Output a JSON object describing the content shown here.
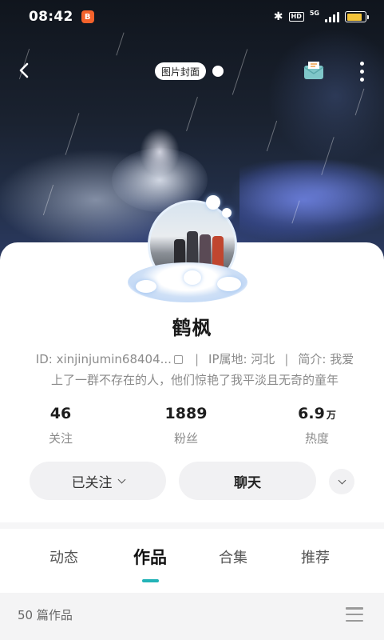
{
  "status_bar": {
    "time": "08:42",
    "app_badge": "B",
    "network": "5G",
    "hd": "HD",
    "battery_level": 0.85,
    "battery_color": "#f2c33a"
  },
  "top_nav": {
    "back_icon": "chevron-left-icon",
    "cover_label": "图片封面",
    "mail_icon": "envelope-icon",
    "more_icon": "more-vertical-icon"
  },
  "profile": {
    "name": "鹤枫",
    "id_text": "ID: xinjinjumin68404...",
    "ip_text": "IP属地:  河北",
    "bio_prefix": "简介: 我爱",
    "bio_line2": "上了一群不存在的人，他们惊艳了我平淡且无奇的童年"
  },
  "stats": [
    {
      "value": "46",
      "unit": "",
      "label": "关注"
    },
    {
      "value": "1889",
      "unit": "",
      "label": "粉丝"
    },
    {
      "value": "6.9",
      "unit": "万",
      "label": "热度"
    }
  ],
  "actions": {
    "follow_label": "已关注",
    "chat_label": "聊天"
  },
  "tabs": [
    {
      "label": "动态",
      "active": false
    },
    {
      "label": "作品",
      "active": true
    },
    {
      "label": "合集",
      "active": false
    },
    {
      "label": "推荐",
      "active": false
    }
  ],
  "works": {
    "count_label": "50 篇作品"
  },
  "colors": {
    "accent": "#23b3b7"
  }
}
